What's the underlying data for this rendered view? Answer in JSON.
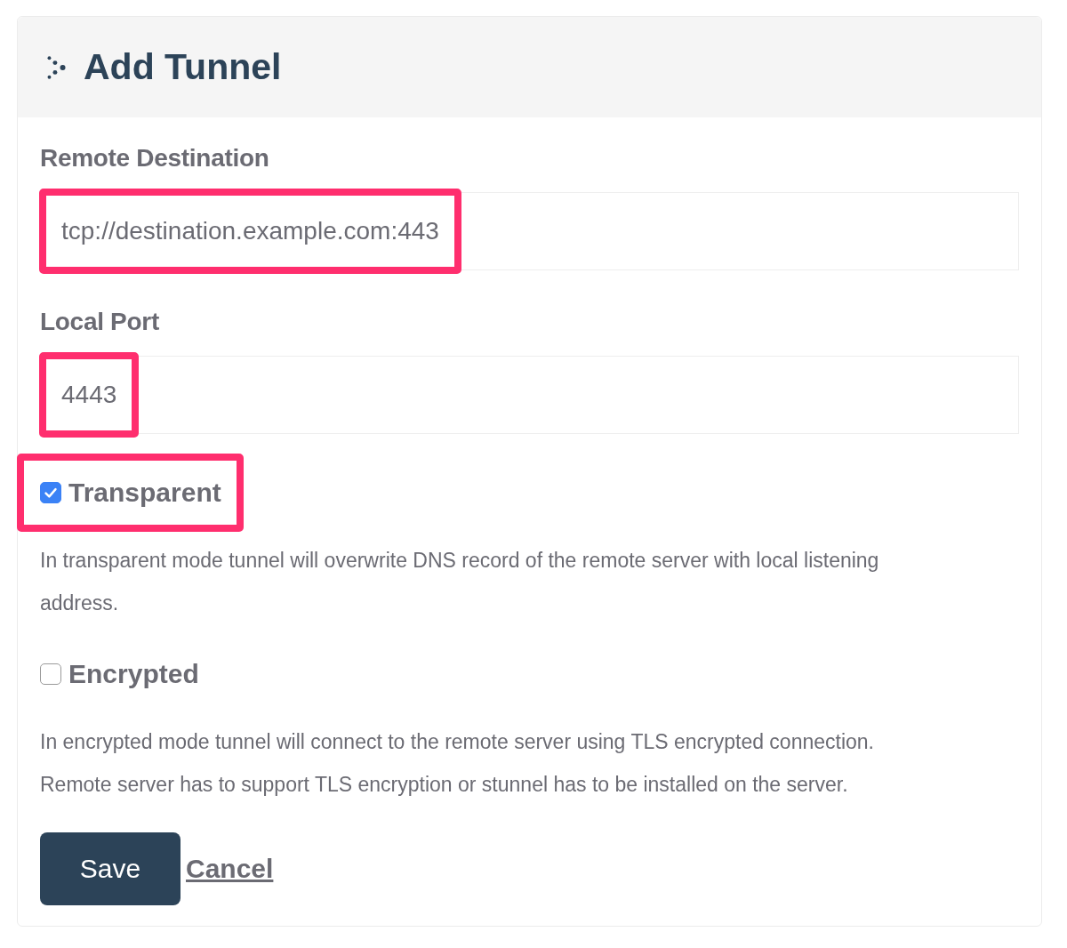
{
  "card": {
    "title": "Add Tunnel"
  },
  "fields": [
    {
      "label": "Remote Destination",
      "value": "tcp://destination.example.com:443",
      "highlighted": true
    },
    {
      "label": "Local Port",
      "value": "4443",
      "highlighted": true
    }
  ],
  "options": [
    {
      "label": "Transparent",
      "checked": true,
      "highlighted": true,
      "description": "In transparent mode tunnel will overwrite DNS record of the remote server with local listening address."
    },
    {
      "label": "Encrypted",
      "checked": false,
      "highlighted": false,
      "description": "In encrypted mode tunnel will connect to the remote server using TLS encrypted connection. Remote server has to support TLS encryption or stunnel has to be installed on the server."
    }
  ],
  "actions": {
    "save": "Save",
    "cancel": "Cancel"
  }
}
